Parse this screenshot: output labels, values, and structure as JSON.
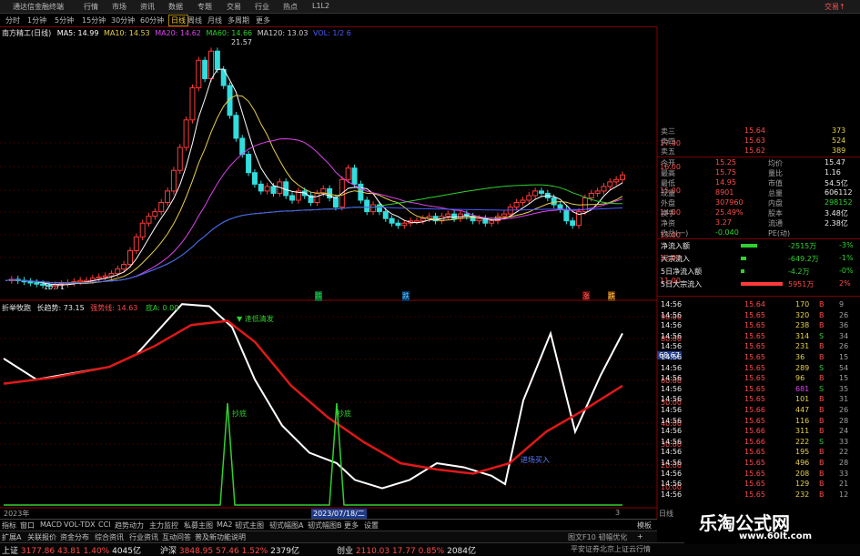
{
  "titlebar": {
    "app": "通达信金融终端",
    "menus": [
      "行情",
      "市场",
      "资讯",
      "数据",
      "专题",
      "交易",
      "行业",
      "热点",
      "L1L2"
    ],
    "right": "交易↑"
  },
  "periods": [
    "分时",
    "1分钟",
    "5分钟",
    "15分钟",
    "30分钟",
    "60分钟",
    "日线",
    "周线",
    "月线",
    "多周期",
    "更多"
  ],
  "active_period": "日线",
  "main_legend": {
    "stock": "南方精工(日线)",
    "ma5": "MA5: 14.99",
    "ma10": "MA10: 14.53",
    "ma20": "MA20: 14.62",
    "ma60": "MA60: 14.66",
    "ma120": "MA120: 13.03",
    "extra": "VOL: 1/2 6"
  },
  "price_annotations": {
    "high": "21.57",
    "low": "10.71"
  },
  "y_axis_main": [
    "17.00",
    "16.00",
    "15.00",
    "14.00",
    "13.00",
    "12.00",
    "11.00"
  ],
  "markers_main": [
    "跌",
    "跌",
    "涨",
    "跌"
  ],
  "sub_legend": {
    "name": "折举牧跑",
    "line1": "长趋势: 73.15",
    "line2": "强势线: 14.63",
    "line3": "底A: 0.00"
  },
  "sub_marker_top": "▼ 逢低清发",
  "sub_labels": {
    "spike1": "抄底",
    "spike2": "抄底",
    "blue": "进场买入"
  },
  "y_axis_sub": [
    "90.00",
    "80.00",
    "70.00",
    "60.00",
    "50.00",
    "40.00",
    "30.00",
    "20.00",
    "10.00"
  ],
  "sub_cursor_value": "68.67",
  "date_axis": {
    "left": "2023年",
    "cursor": "2023/07/18/二",
    "right": "3"
  },
  "quote": {
    "orders": [
      {
        "label": "卖三",
        "price": "15.64",
        "vol": "373"
      },
      {
        "label": "卖四",
        "price": "15.63",
        "vol": "524"
      },
      {
        "label": "卖五",
        "price": "15.62",
        "vol": "389"
      }
    ],
    "stats": [
      {
        "l1": "今开",
        "v1": "15.25",
        "l2": "均价",
        "v2": "15.47"
      },
      {
        "l1": "最高",
        "v1": "15.75",
        "l2": "量比",
        "v2": "1.16"
      },
      {
        "l1": "最低",
        "v1": "14.95",
        "l2": "市值",
        "v2": "54.5亿"
      },
      {
        "l1": "现量",
        "v1": "8901",
        "l2": "总量",
        "v2": "606112"
      },
      {
        "l1": "外盘",
        "v1": "307960",
        "l2": "内盘",
        "v2": "298152"
      },
      {
        "l1": "换手",
        "v1": "25.49%",
        "l2": "股本",
        "v2": "3.48亿"
      },
      {
        "l1": "净资",
        "v1": "3.27",
        "l2": "流通",
        "v2": "2.38亿"
      },
      {
        "l1": "收益(一)",
        "v1": "-0.040",
        "l2": "PE(动)",
        "v2": ""
      }
    ],
    "flows": [
      {
        "label": "净流入额",
        "value": "-2515万",
        "pct": "-3%"
      },
      {
        "label": "大宗流入",
        "value": "-649.2万",
        "pct": "-1%"
      },
      {
        "label": "5日净流入额",
        "value": "-4.2万",
        "pct": "-0%"
      },
      {
        "label": "5日大宗流入",
        "value": "5951万",
        "pct": "2%"
      }
    ],
    "ticks": [
      {
        "time": "14:56",
        "price": "15.64",
        "vol": "170",
        "side": "B",
        "num": "9"
      },
      {
        "time": "14:56",
        "price": "15.65",
        "vol": "320",
        "side": "B",
        "num": "26"
      },
      {
        "time": "14:56",
        "price": "15.65",
        "vol": "238",
        "side": "B",
        "num": "36"
      },
      {
        "time": "14:56",
        "price": "15.65",
        "vol": "314",
        "side": "S",
        "num": "34"
      },
      {
        "time": "14:56",
        "price": "15.65",
        "vol": "231",
        "side": "B",
        "num": "26"
      },
      {
        "time": "14:56",
        "price": "15.65",
        "vol": "36",
        "side": "B",
        "num": "15"
      },
      {
        "time": "14:56",
        "price": "15.65",
        "vol": "289",
        "side": "S",
        "num": "54"
      },
      {
        "time": "14:56",
        "price": "15.65",
        "vol": "96",
        "side": "B",
        "num": "15"
      },
      {
        "time": "14:56",
        "price": "15.65",
        "vol": "681",
        "side": "S",
        "num": "35"
      },
      {
        "time": "14:56",
        "price": "15.65",
        "vol": "101",
        "side": "B",
        "num": "31"
      },
      {
        "time": "14:56",
        "price": "15.66",
        "vol": "447",
        "side": "B",
        "num": "26"
      },
      {
        "time": "14:56",
        "price": "15.65",
        "vol": "116",
        "side": "B",
        "num": "28"
      },
      {
        "time": "14:56",
        "price": "15.66",
        "vol": "311",
        "side": "B",
        "num": "24"
      },
      {
        "time": "14:56",
        "price": "15.66",
        "vol": "222",
        "side": "S",
        "num": "33"
      },
      {
        "time": "14:56",
        "price": "15.65",
        "vol": "195",
        "side": "B",
        "num": "22"
      },
      {
        "time": "14:56",
        "price": "15.65",
        "vol": "496",
        "side": "B",
        "num": "28"
      },
      {
        "time": "14:56",
        "price": "15.65",
        "vol": "208",
        "side": "B",
        "num": "33"
      },
      {
        "time": "14:56",
        "price": "15.65",
        "vol": "129",
        "side": "B",
        "num": "21"
      },
      {
        "time": "14:56",
        "price": "15.65",
        "vol": "232",
        "side": "B",
        "num": "12"
      }
    ],
    "footer": "日线"
  },
  "indicator_tabs": [
    "指标",
    "窗口",
    "MACD",
    "VOL-TDX",
    "CCI",
    "趋势动力",
    "主力监控",
    "私募主图",
    "MA2",
    "韧式主图",
    "韧式幅图A",
    "韧式幅图B",
    "更多",
    "设置"
  ],
  "subtabs": [
    "扩展A",
    "关联报价",
    "资金分布",
    "综合资讯",
    "行业资讯",
    "互动问答",
    "普及新功能说明"
  ],
  "subtab_right": [
    "模板",
    "+"
  ],
  "index_bar": [
    {
      "name": "上证",
      "value": "3177.86",
      "chg": "43.81",
      "pct": "1.40%",
      "amt": "4045亿"
    },
    {
      "name": "沪深",
      "value": "3848.95",
      "chg": "57.46",
      "pct": "1.52%",
      "amt": "2379亿"
    },
    {
      "name": "创业",
      "value": "2110.03",
      "chg": "17.77",
      "pct": "0.85%",
      "amt": "2084亿"
    }
  ],
  "index_right": "平安证券北京上证云行情",
  "status_right": "图文F10 韧幅优化",
  "watermark": {
    "title": "乐淘公式网",
    "url": "www.60lt.com"
  },
  "colors": {
    "ma5": "#ffffff",
    "ma10": "#e6d04a",
    "ma20": "#dd44ee",
    "ma60": "#2fd12f",
    "ma120": "#4a5cff",
    "up": "#ff3b3b",
    "down": "#33dddd",
    "sub_white": "#ffffff",
    "sub_red": "#e01818",
    "sub_green": "#2fd12f"
  }
}
